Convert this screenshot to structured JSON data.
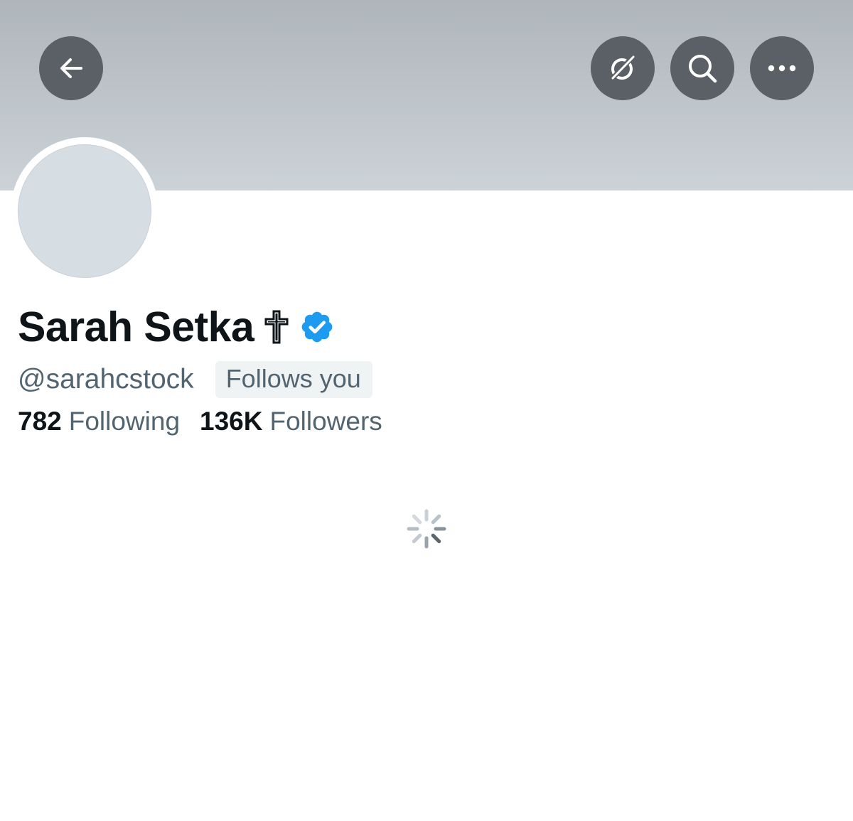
{
  "header": {
    "back_icon": "arrow-left-icon",
    "grok_icon": "grok-icon",
    "search_icon": "search-icon",
    "more_icon": "more-horizontal-icon",
    "banner_color": "#b9c0c6"
  },
  "profile": {
    "name": "Sarah Setka",
    "name_emoji": "cross-icon",
    "verified": true,
    "verified_color": "#1d9bf0",
    "handle": "@sarahcstock",
    "follows_you": "Follows you",
    "following_count": "782",
    "following_label": "Following",
    "followers_count": "136K",
    "followers_label": "Followers"
  },
  "content": {
    "state": "loading"
  }
}
